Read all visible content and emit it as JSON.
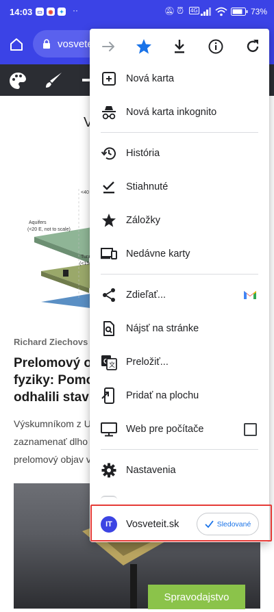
{
  "status_bar": {
    "time": "14:03",
    "battery": "73%"
  },
  "browser": {
    "url": "vosveteit.sk"
  },
  "site": {
    "header_text": "V"
  },
  "article": {
    "figure_labels": [
      "<40",
      "Aquifers",
      "(<20 E, not to scale)",
      "Tunne",
      "(<150"
    ],
    "author": "Richard Ziechovs",
    "headline": [
      "Prelomový ob",
      "fyziky: Pomo",
      "odhalili stavb"
    ],
    "excerpt": [
      "Výskumníkom z U",
      "zaznamenať dlho",
      "prelomový objav v"
    ],
    "category_button": "Spravodajstvo"
  },
  "menu": {
    "top_icons": [
      "arrow-forward-icon",
      "star-icon",
      "download-icon",
      "info-icon",
      "reload-icon"
    ],
    "items": [
      {
        "label": "Nová karta",
        "icon": "new-tab-icon"
      },
      {
        "label": "Nová karta inkognito",
        "icon": "incognito-icon"
      },
      {
        "label": "História",
        "icon": "history-icon"
      },
      {
        "label": "Stiahnuté",
        "icon": "downloads-icon"
      },
      {
        "label": "Záložky",
        "icon": "bookmarks-star-icon"
      },
      {
        "label": "Nedávne karty",
        "icon": "recent-tabs-icon"
      },
      {
        "label": "Zdieľať...",
        "icon": "share-icon"
      },
      {
        "label": "Nájsť na stránke",
        "icon": "find-in-page-icon"
      },
      {
        "label": "Preložiť...",
        "icon": "translate-icon"
      },
      {
        "label": "Pridať na plochu",
        "icon": "add-to-home-icon"
      },
      {
        "label": "Web pre počítače",
        "icon": "desktop-site-icon"
      },
      {
        "label": "Nastavenia",
        "icon": "settings-icon"
      }
    ],
    "desktop_site_checked": false,
    "follow": {
      "avatar_text": "IT",
      "site_name": "Vosveteit.sk",
      "button_label": "Sledované"
    },
    "colors": {
      "accent_blue": "#1a73e8",
      "brand_bar": "#3b43e6",
      "highlight_red": "#e53935"
    }
  }
}
